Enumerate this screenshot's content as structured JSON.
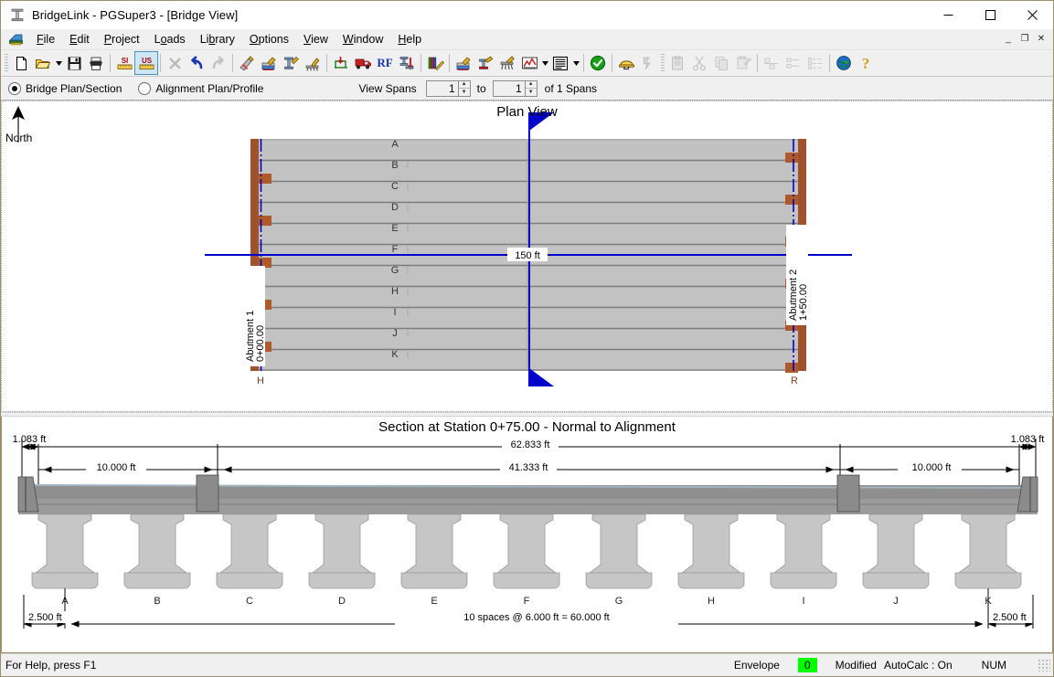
{
  "window": {
    "title": "BridgeLink - PGSuper3 - [Bridge View]",
    "minimize": "─",
    "maximize": "☐",
    "close": "✕",
    "mdi_minimize": "_",
    "mdi_restore": "❐",
    "mdi_close": "✕"
  },
  "menu": {
    "items": [
      {
        "label": "File",
        "accel": "F"
      },
      {
        "label": "Edit",
        "accel": "E"
      },
      {
        "label": "Project",
        "accel": "P"
      },
      {
        "label": "Loads",
        "accel": "o"
      },
      {
        "label": "Library",
        "accel": "b"
      },
      {
        "label": "Options",
        "accel": "O"
      },
      {
        "label": "View",
        "accel": "V"
      },
      {
        "label": "Window",
        "accel": "W"
      },
      {
        "label": "Help",
        "accel": "H"
      }
    ]
  },
  "toolbar": {
    "buttons": [
      {
        "name": "new-file-icon",
        "tip": "New"
      },
      {
        "name": "open-file-icon",
        "tip": "Open"
      },
      {
        "name": "open-dropdown-caret-icon",
        "tip": "Recent files"
      },
      {
        "name": "save-icon",
        "tip": "Save"
      },
      {
        "name": "print-icon",
        "tip": "Print"
      },
      {
        "name": "si-units-icon",
        "tip": "SI Units",
        "label": "SI"
      },
      {
        "name": "us-units-icon",
        "tip": "US Units",
        "label": "US",
        "active": true
      },
      {
        "name": "delete-icon",
        "tip": "Delete"
      },
      {
        "name": "undo-icon",
        "tip": "Undo"
      },
      {
        "name": "redo-icon",
        "tip": "Redo"
      },
      {
        "name": "edit-bridge-icon",
        "tip": "Edit Bridge"
      },
      {
        "name": "edit-deck-icon",
        "tip": "Edit Deck"
      },
      {
        "name": "edit-girder-icon",
        "tip": "Edit Girder"
      },
      {
        "name": "edit-pier-icon",
        "tip": "Edit Pier"
      },
      {
        "name": "loads-icon",
        "tip": "Loads"
      },
      {
        "name": "live-load-truck-icon",
        "tip": "Live Loads"
      },
      {
        "name": "rating-icon",
        "tip": "Load Rating",
        "label": "RF"
      },
      {
        "name": "design-girder-icon",
        "tip": "Design Girder"
      },
      {
        "name": "library-editor-icon",
        "tip": "Library Editor"
      },
      {
        "name": "deck-view-icon",
        "tip": "Deck View"
      },
      {
        "name": "girder-view-icon",
        "tip": "Girder View"
      },
      {
        "name": "pier-view-icon",
        "tip": "Pier View"
      },
      {
        "name": "graph-view-icon",
        "tip": "Graphs"
      },
      {
        "name": "graph-dropdown-caret-icon",
        "tip": "Graph list"
      },
      {
        "name": "report-view-icon",
        "tip": "Reports"
      },
      {
        "name": "report-dropdown-caret-icon",
        "tip": "Report list"
      },
      {
        "name": "spec-check-icon",
        "tip": "Specification Check"
      },
      {
        "name": "design-helper-icon",
        "tip": "Design"
      },
      {
        "name": "analysis-icon",
        "tip": "Analysis"
      },
      {
        "name": "paste-special-icon",
        "tip": "Paste Special"
      },
      {
        "name": "cut-icon",
        "tip": "Cut"
      },
      {
        "name": "copy-icon",
        "tip": "Copy"
      },
      {
        "name": "paste-icon",
        "tip": "Paste"
      },
      {
        "name": "align-left-icon",
        "tip": "Align"
      },
      {
        "name": "list-small-icon",
        "tip": "List"
      },
      {
        "name": "list-detail-icon",
        "tip": "Details"
      },
      {
        "name": "web-help-icon",
        "tip": "Online"
      },
      {
        "name": "about-help-icon",
        "tip": "Help"
      }
    ]
  },
  "viewbar": {
    "bridge_plan_section": "Bridge Plan/Section",
    "alignment_plan_profile": "Alignment Plan/Profile",
    "selected": "Bridge Plan/Section",
    "view_spans_label": "View Spans",
    "span_from": "1",
    "to_label": "to",
    "span_to": "1",
    "of_spans_label": "of 1 Spans",
    "spin_up": "▲",
    "spin_down": "▼"
  },
  "plan_view": {
    "title": "Plan View",
    "north_label": "North",
    "girder_labels": [
      "A",
      "B",
      "C",
      "D",
      "E",
      "F",
      "G",
      "H",
      "I",
      "J",
      "K"
    ],
    "span_length_label": "150 ft",
    "abutment_1_label": "Abutment 1",
    "abutment_1_station": "0+00.00",
    "abutment_2_label": "Abutment 2",
    "abutment_2_station": "1+50.00",
    "left_corner_label": "H",
    "right_corner_label": "R"
  },
  "section_view": {
    "title": "Section at Station 0+75.00 - Normal to Alignment",
    "dim_overall": "62.833 ft",
    "dim_roadway": "41.333 ft",
    "dim_left_barrier": "1.083 ft",
    "dim_right_barrier": "1.083 ft",
    "dim_left_shoulder": "10.000 ft",
    "dim_right_shoulder": "10.000 ft",
    "dim_left_overhang": "2.500 ft",
    "dim_right_overhang": "2.500 ft",
    "dim_spacing": "10 spaces @ 6.000 ft = 60.000 ft",
    "girder_labels": [
      "A",
      "B",
      "C",
      "D",
      "E",
      "F",
      "G",
      "H",
      "I",
      "J",
      "K"
    ]
  },
  "statusbar": {
    "help_text": "For Help, press F1",
    "envelope": "Envelope",
    "count_badge": "0",
    "modified": "Modified",
    "autocalc": "AutoCalc : On",
    "num_lock": "NUM"
  },
  "colors": {
    "accent": "#0000cd",
    "abutment": "#a0522d",
    "girder_fill": "#c0c0c0",
    "deck_fill": "#b3b3b3",
    "status_green": "#00ff00",
    "window_frame": "#9a8f6a"
  }
}
